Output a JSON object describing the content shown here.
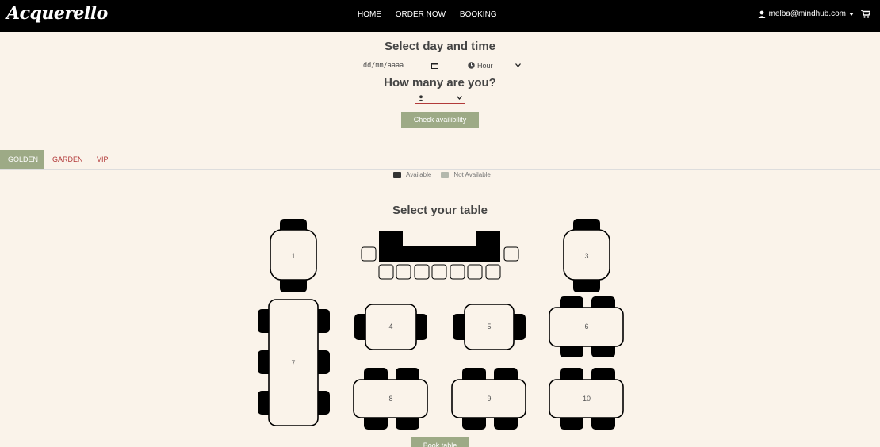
{
  "nav": {
    "logo": "Acquerello",
    "links": [
      "HOME",
      "ORDER NOW",
      "BOOKING"
    ],
    "user_email": "melba@mindhub.com"
  },
  "booking": {
    "title_datetime": "Select day and time",
    "date_placeholder": "dd/mm/aaaa",
    "hour_label": "Hour",
    "title_people": "How many are you?",
    "check_button": "Check availibility"
  },
  "tabs": [
    {
      "label": "GOLDEN",
      "active": true
    },
    {
      "label": "GARDEN",
      "active": false
    },
    {
      "label": "VIP",
      "active": false
    }
  ],
  "legend": {
    "available": "Available",
    "not_available": "Not Available",
    "available_color": "#333333",
    "not_available_color": "#b3b8ad"
  },
  "floor": {
    "title": "Select your table",
    "tables": [
      "1",
      "3",
      "4",
      "5",
      "6",
      "7",
      "8",
      "9",
      "10"
    ]
  },
  "book_button": "Book table",
  "colors": {
    "accent": "#9daa86",
    "danger": "#b23a3a",
    "background": "#faf3ea"
  }
}
